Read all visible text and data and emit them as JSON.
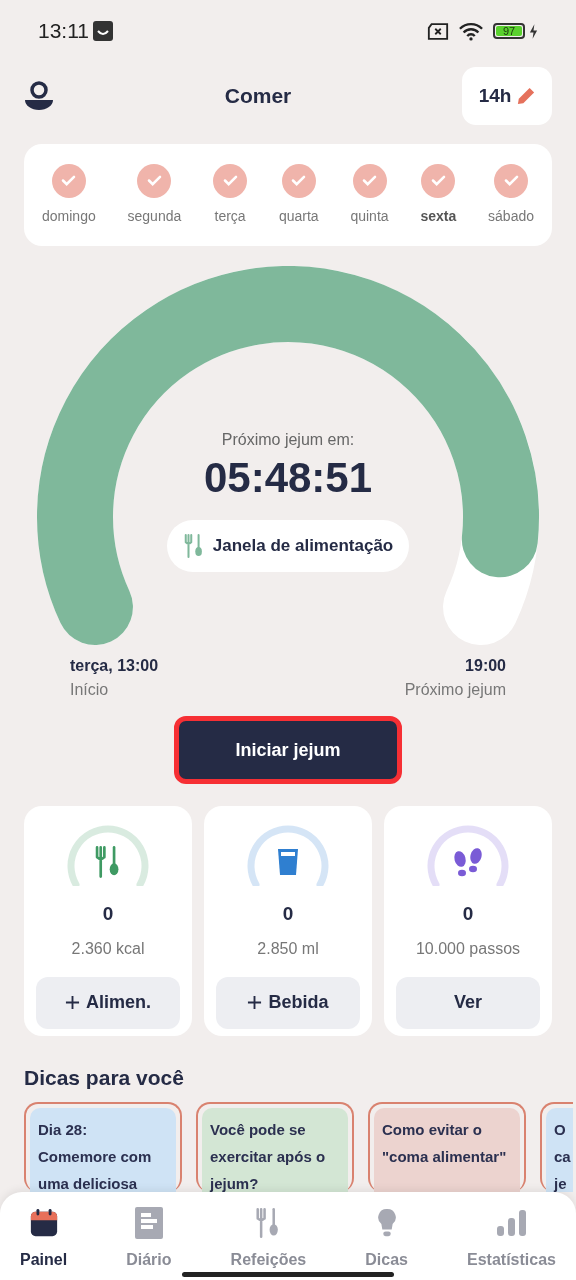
{
  "status_bar": {
    "time": "13:11",
    "battery": "97"
  },
  "header": {
    "title": "Comer",
    "fast_hours": "14h"
  },
  "week": [
    {
      "label": "domingo",
      "checked": true,
      "today": false
    },
    {
      "label": "segunda",
      "checked": true,
      "today": false
    },
    {
      "label": "terça",
      "checked": true,
      "today": false
    },
    {
      "label": "quarta",
      "checked": true,
      "today": false
    },
    {
      "label": "quinta",
      "checked": true,
      "today": false
    },
    {
      "label": "sexta",
      "checked": true,
      "today": true
    },
    {
      "label": "sábado",
      "checked": true,
      "today": false
    }
  ],
  "timer": {
    "caption": "Próximo jejum em:",
    "time": "05:48:51",
    "mode": "Janela de alimentação",
    "start_time": "terça, 13:00",
    "start_label": "Início",
    "end_time": "19:00",
    "end_label": "Próximo jejum"
  },
  "start_button": "Iniciar jejum",
  "trackers": [
    {
      "kind": "food",
      "value": "0",
      "goal": "2.360 kcal",
      "button": "Alimen.",
      "plus": true
    },
    {
      "kind": "drink",
      "value": "0",
      "goal": "2.850 ml",
      "button": "Bebida",
      "plus": true
    },
    {
      "kind": "steps",
      "value": "0",
      "goal": "10.000 passos",
      "button": "Ver",
      "plus": false
    }
  ],
  "tips_title": "Dicas para você",
  "tips": [
    {
      "text": "Dia 28:\nComemore com\numa deliciosa",
      "color": "#cfe3f5"
    },
    {
      "text": "Você pode se\nexercitar após o\njejum?",
      "color": "#d3e6d4"
    },
    {
      "text": "Como evitar o\n\"coma alimentar\"",
      "color": "#ecd3cf"
    },
    {
      "text": "O\nca\nje",
      "color": "#cfe3f5"
    }
  ],
  "nav": [
    {
      "kind": "calendar",
      "label": "Painel",
      "selected": true
    },
    {
      "kind": "diary",
      "label": "Diário",
      "selected": false
    },
    {
      "kind": "meals",
      "label": "Refeições",
      "selected": false
    },
    {
      "kind": "tips",
      "label": "Dicas",
      "selected": false
    },
    {
      "kind": "stats",
      "label": "Estatísticas",
      "selected": false
    }
  ]
}
